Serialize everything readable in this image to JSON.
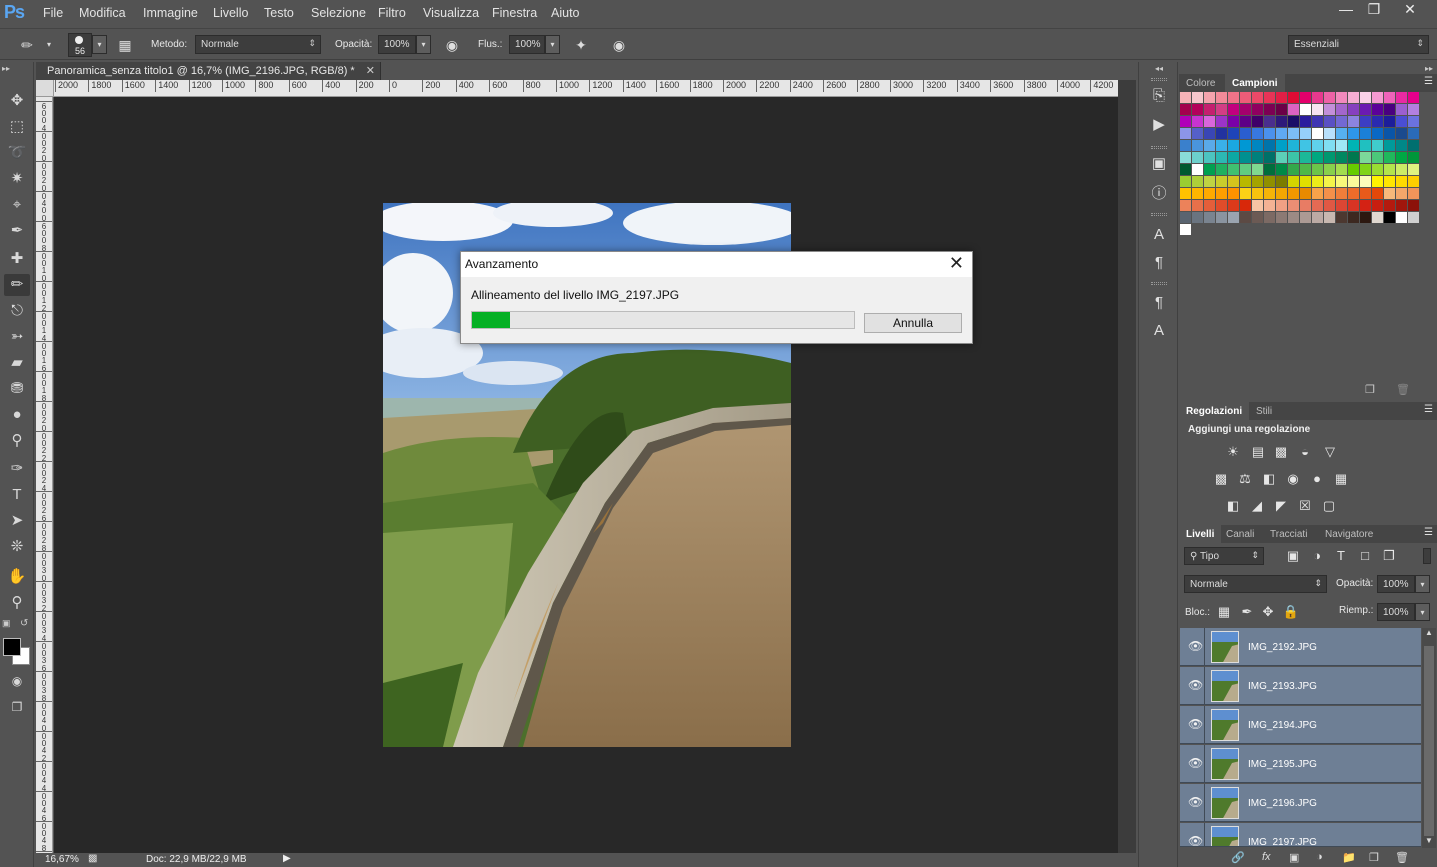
{
  "app": {
    "logo": "Ps",
    "menu": [
      "File",
      "Modifica",
      "Immagine",
      "Livello",
      "Testo",
      "Selezione",
      "Filtro",
      "Visualizza",
      "Finestra",
      "Aiuto"
    ],
    "window_controls": [
      "minimize",
      "restore",
      "close"
    ]
  },
  "options_bar": {
    "brush_size": "56",
    "mode_label": "Metodo:",
    "mode_value": "Normale",
    "opacity_label": "Opacità:",
    "opacity_value": "100%",
    "flow_label": "Flus.:",
    "flow_value": "100%",
    "workspace": "Essenziali"
  },
  "document": {
    "tab_title": "Panoramica_senza titolo1 @ 16,7% (IMG_2196.JPG, RGB/8) *",
    "ruler_top": [
      "2000",
      "1800",
      "1600",
      "1400",
      "1200",
      "1000",
      "800",
      "600",
      "400",
      "200",
      "0",
      "200",
      "400",
      "600",
      "800",
      "1000",
      "1200",
      "1400",
      "1600",
      "1800",
      "2000",
      "2200",
      "2400",
      "2600",
      "2800",
      "3000",
      "3200",
      "3400",
      "3600",
      "3800",
      "4000",
      "4200"
    ],
    "ruler_left": [
      "6",
      "0",
      "0",
      "4",
      "0",
      "0",
      "2",
      "0",
      "0",
      "0",
      "2",
      "0",
      "0",
      "4",
      "0",
      "0",
      "6",
      "0",
      "0",
      "8",
      "0",
      "0",
      "1",
      "0",
      "0",
      "0",
      "1",
      "2",
      "0",
      "0",
      "1",
      "4",
      "0",
      "0",
      "1",
      "6",
      "0",
      "0",
      "1",
      "8",
      "0",
      "0",
      "2",
      "0",
      "0",
      "0",
      "2",
      "2",
      "0",
      "0",
      "2",
      "4",
      "0",
      "0",
      "2",
      "6",
      "0",
      "0",
      "2",
      "8",
      "0",
      "0",
      "3",
      "0",
      "0",
      "0",
      "3",
      "2",
      "0",
      "0",
      "3",
      "4",
      "0",
      "0",
      "3",
      "6",
      "0",
      "0",
      "3",
      "8",
      "0",
      "0",
      "4",
      "0",
      "0",
      "0",
      "4",
      "2",
      "0",
      "0",
      "4",
      "4",
      "0",
      "0",
      "4",
      "6",
      "0",
      "0",
      "4",
      "8",
      "0",
      "0",
      "5",
      "0",
      "0",
      "0"
    ],
    "zoom": "16,67%",
    "doc_info": "Doc: 22,9 MB/22,9 MB"
  },
  "dialog": {
    "title": "Avanzamento",
    "message": "Allineamento del livello IMG_2197.JPG",
    "progress": 0.1,
    "cancel_label": "Annulla"
  },
  "panels": {
    "color_tabs": [
      "Colore",
      "Campioni"
    ],
    "adjust_tabs": [
      "Regolazioni",
      "Stili"
    ],
    "adjust_title": "Aggiungi una regolazione",
    "layer_tabs": [
      "Livelli",
      "Canali",
      "Tracciati",
      "Navigatore"
    ],
    "filter_kind": "Tipo",
    "blend_mode": "Normale",
    "opacity_label": "Opacità:",
    "opacity_value": "100%",
    "lock_label": "Bloc.:",
    "fill_label": "Riemp.:",
    "fill_value": "100%",
    "layers": [
      "IMG_2192.JPG",
      "IMG_2193.JPG",
      "IMG_2194.JPG",
      "IMG_2195.JPG",
      "IMG_2196.JPG",
      "IMG_2197.JPG"
    ]
  },
  "swatch_rows": [
    [
      "#f6b2b7",
      "#f7c6cc",
      "#f5a3ad",
      "#f38a99",
      "#f07389",
      "#ee5c78",
      "#ec4968",
      "#e73457",
      "#e21f46",
      "#de0b34",
      "#e4006b",
      "#e8398e",
      "#ed62a6",
      "#f289bd",
      "#f6add3",
      "#fad0e7",
      "#f59ad1",
      "#ef63ba",
      "#ea2aa2",
      "#e6008c"
    ],
    [
      "#a3004e",
      "#b3005a",
      "#c51f6f",
      "#d33d85",
      "#c2007f",
      "#a4006d",
      "#8f0060",
      "#7c0053",
      "#6a0047",
      "#db63c2",
      "#ffffff",
      "#f7e3f1",
      "#c38fd9",
      "#a366cc",
      "#8740bf",
      "#6b1ab2",
      "#5c0099",
      "#4a007f",
      "#9b5fd0",
      "#b380e0"
    ],
    [
      "#b000b8",
      "#c734d0",
      "#d966dc",
      "#9b34c8",
      "#7a00a8",
      "#5e0087",
      "#3f0069",
      "#4a2e8e",
      "#2e1a7a",
      "#1a0d66",
      "#2b1d9e",
      "#4035b3",
      "#5a50c4",
      "#7369d3",
      "#8c84e0",
      "#3c3dc4",
      "#2a2ab0",
      "#1d1d9a",
      "#4a4ed4",
      "#6b72e0"
    ],
    [
      "#8c95e8",
      "#5560c8",
      "#3a46b5",
      "#2232a0",
      "#1e44b8",
      "#2a5ed0",
      "#3878e0",
      "#4b91ec",
      "#5fa9f4",
      "#7cbef7",
      "#96d0fa",
      "#ffffff",
      "#b8e0fc",
      "#56b0f0",
      "#2e96e8",
      "#1a80d8",
      "#0a68c4",
      "#0a55a8",
      "#1a4a8e",
      "#2a6bb8"
    ],
    [
      "#3a80cc",
      "#4a95dd",
      "#5aaae8",
      "#3ab0e8",
      "#1aa8e0",
      "#0098d4",
      "#0086c0",
      "#0074ab",
      "#00a0c8",
      "#20b4d8",
      "#40c4e4",
      "#60d2ec",
      "#80def2",
      "#a0e8f6",
      "#00b4b4",
      "#20c0c0",
      "#40cccc",
      "#009a9a",
      "#008888",
      "#006f6f"
    ],
    [
      "#8adcd8",
      "#6cd0cc",
      "#4cc4c0",
      "#2cb8b4",
      "#0ca8a4",
      "#009090",
      "#00807c",
      "#007068",
      "#5cd0b8",
      "#3cc4a8",
      "#1cb898",
      "#00a880",
      "#009870",
      "#008860",
      "#00784f",
      "#7cd89a",
      "#4cc87a",
      "#20b85c",
      "#00a844",
      "#00963a"
    ],
    [
      "#005a30",
      "#ffffff",
      "#00a050",
      "#20b060",
      "#40c070",
      "#60cc80",
      "#80d890",
      "#006e3c",
      "#008a46",
      "#34a84a",
      "#50b848",
      "#6cc44a",
      "#88d04c",
      "#a4dc4e",
      "#66cc00",
      "#80d41a",
      "#99dc33",
      "#b3e44c",
      "#ccec66",
      "#e0f280"
    ],
    [
      "#9acd32",
      "#adcf3a",
      "#bfd343",
      "#c9cc2c",
      "#d4c41e",
      "#b8b800",
      "#a4a400",
      "#909000",
      "#7c7c00",
      "#d4d400",
      "#e0e000",
      "#ecec1a",
      "#f4f44a",
      "#f8f87a",
      "#fafa9a",
      "#fcfcbc",
      "#fff200",
      "#ffe600",
      "#ffda00",
      "#ffce00"
    ],
    [
      "#ffc200",
      "#ffb600",
      "#ffaa00",
      "#ff9e00",
      "#ff9200",
      "#fcd116",
      "#f9c30f",
      "#f6b408",
      "#f3a601",
      "#f09700",
      "#e88a00",
      "#f7a24a",
      "#f4904a",
      "#f07e3a",
      "#ec6c2a",
      "#e85a1a",
      "#e4480a",
      "#f7b87a",
      "#f4a66a",
      "#f0945a"
    ],
    [
      "#ec825a",
      "#e8704a",
      "#e45e3a",
      "#e04c2a",
      "#dc3a1a",
      "#d8280a",
      "#f7c4a4",
      "#f4b294",
      "#f0a084",
      "#ec8e74",
      "#e87c64",
      "#e46a54",
      "#e05844",
      "#dc4634",
      "#d83424",
      "#d42214",
      "#c81e10",
      "#b41a0e",
      "#a0160c",
      "#8c120a"
    ],
    [
      "#5a6470",
      "#6a7480",
      "#7a8490",
      "#8a94a0",
      "#9aa4b0",
      "#5c4a44",
      "#6c5a54",
      "#7c6a64",
      "#8c7a74",
      "#9c8a84",
      "#ac9a94",
      "#bcaaa4",
      "#c8b8b0",
      "#4c3830",
      "#3c2820",
      "#2c1810",
      "#e0d8d0",
      "#000000",
      "#ffffff",
      "#d0d0d0"
    ],
    [
      "#ffffff"
    ]
  ]
}
